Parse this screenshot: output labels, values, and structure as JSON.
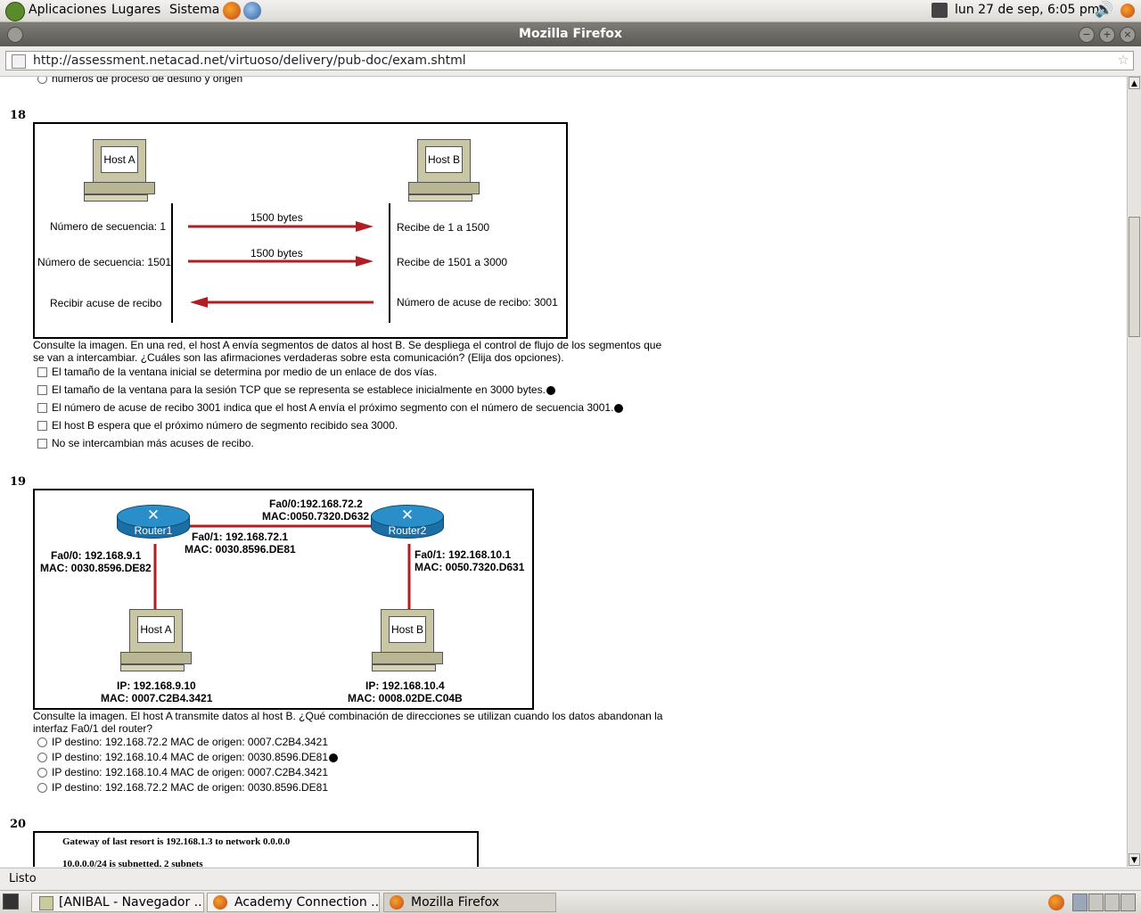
{
  "panel": {
    "menus": [
      "Aplicaciones",
      "Lugares",
      "Sistema"
    ],
    "clock": "lun 27 de sep,  6:05 pm"
  },
  "window": {
    "title": "Mozilla Firefox",
    "url": "http://assessment.netacad.net/virtuoso/delivery/pub-doc/exam.shtml",
    "status": "Listo"
  },
  "prev_option": "números de proceso de destino y origen",
  "q18": {
    "number": "18",
    "figure": {
      "host_a": "Host A",
      "host_b": "Host B",
      "left_labels": [
        "Número de secuencia: 1",
        "Número de secuencia: 1501",
        "Recibir acuse de recibo"
      ],
      "arrow_labels": [
        "1500 bytes",
        "1500 bytes"
      ],
      "right_labels": [
        "Recibe de 1 a 1500",
        "Recibe de 1501 a 3000",
        "Número de acuse de recibo: 3001"
      ]
    },
    "question": "Consulte la imagen. En una red, el host A envía segmentos de datos al host B. Se despliega el control de flujo de los segmentos que se van a intercambiar. ¿Cuáles son las afirmaciones verdaderas sobre esta comunicación? (Elija dos opciones).",
    "options": [
      {
        "text": "El tamaño de la ventana inicial se determina por medio de un enlace de dos vías.",
        "marked": false
      },
      {
        "text": "El tamaño de la ventana para la sesión TCP que se representa se establece inicialmente en 3000 bytes.",
        "marked": true
      },
      {
        "text": "El número de acuse de recibo 3001 indica que el host A envía el próximo segmento con el número de secuencia 3001.",
        "marked": true
      },
      {
        "text": "El host B espera que el próximo número de segmento recibido sea 3000.",
        "marked": false
      },
      {
        "text": "No se intercambian más acuses de recibo.",
        "marked": false
      }
    ]
  },
  "q19": {
    "number": "19",
    "figure": {
      "router1": "Router1",
      "router2": "Router2",
      "host_a": "Host A",
      "host_b": "Host B",
      "r2_fa00": [
        "Fa0/0:192.168.72.2",
        "MAC:0050.7320.D632"
      ],
      "r1_fa01": [
        "Fa0/1: 192.168.72.1",
        "MAC: 0030.8596.DE81"
      ],
      "r1_fa00": [
        "Fa0/0: 192.168.9.1",
        "MAC: 0030.8596.DE82"
      ],
      "r2_fa01": [
        "Fa0/1: 192.168.10.1",
        "MAC: 0050.7320.D631"
      ],
      "host_a_addr": [
        "IP: 192.168.9.10",
        "MAC: 0007.C2B4.3421"
      ],
      "host_b_addr": [
        "IP: 192.168.10.4",
        "MAC: 0008.02DE.C04B"
      ]
    },
    "question": "Consulte la imagen. El host A transmite datos al host B. ¿Qué combinación de direcciones se utilizan cuando los datos abandonan la interfaz Fa0/1 del router?",
    "options": [
      {
        "text": "IP destino: 192.168.72.2 MAC de origen: 0007.C2B4.3421",
        "marked": false
      },
      {
        "text": "IP destino: 192.168.10.4 MAC de origen: 0030.8596.DE81",
        "marked": true
      },
      {
        "text": "IP destino: 192.168.10.4 MAC de origen: 0007.C2B4.3421",
        "marked": false
      },
      {
        "text": "IP destino: 192.168.72.2 MAC de origen: 0030.8596.DE81",
        "marked": false
      }
    ]
  },
  "q20": {
    "number": "20",
    "lines": [
      "Gateway of last resort is 192.168.1.3 to network 0.0.0.0",
      "10.0.0.0/24 is subnetted, 2 subnets"
    ]
  },
  "taskbar": [
    "[ANIBAL - Navegador ...",
    "Academy Connection ...",
    "Mozilla Firefox"
  ]
}
